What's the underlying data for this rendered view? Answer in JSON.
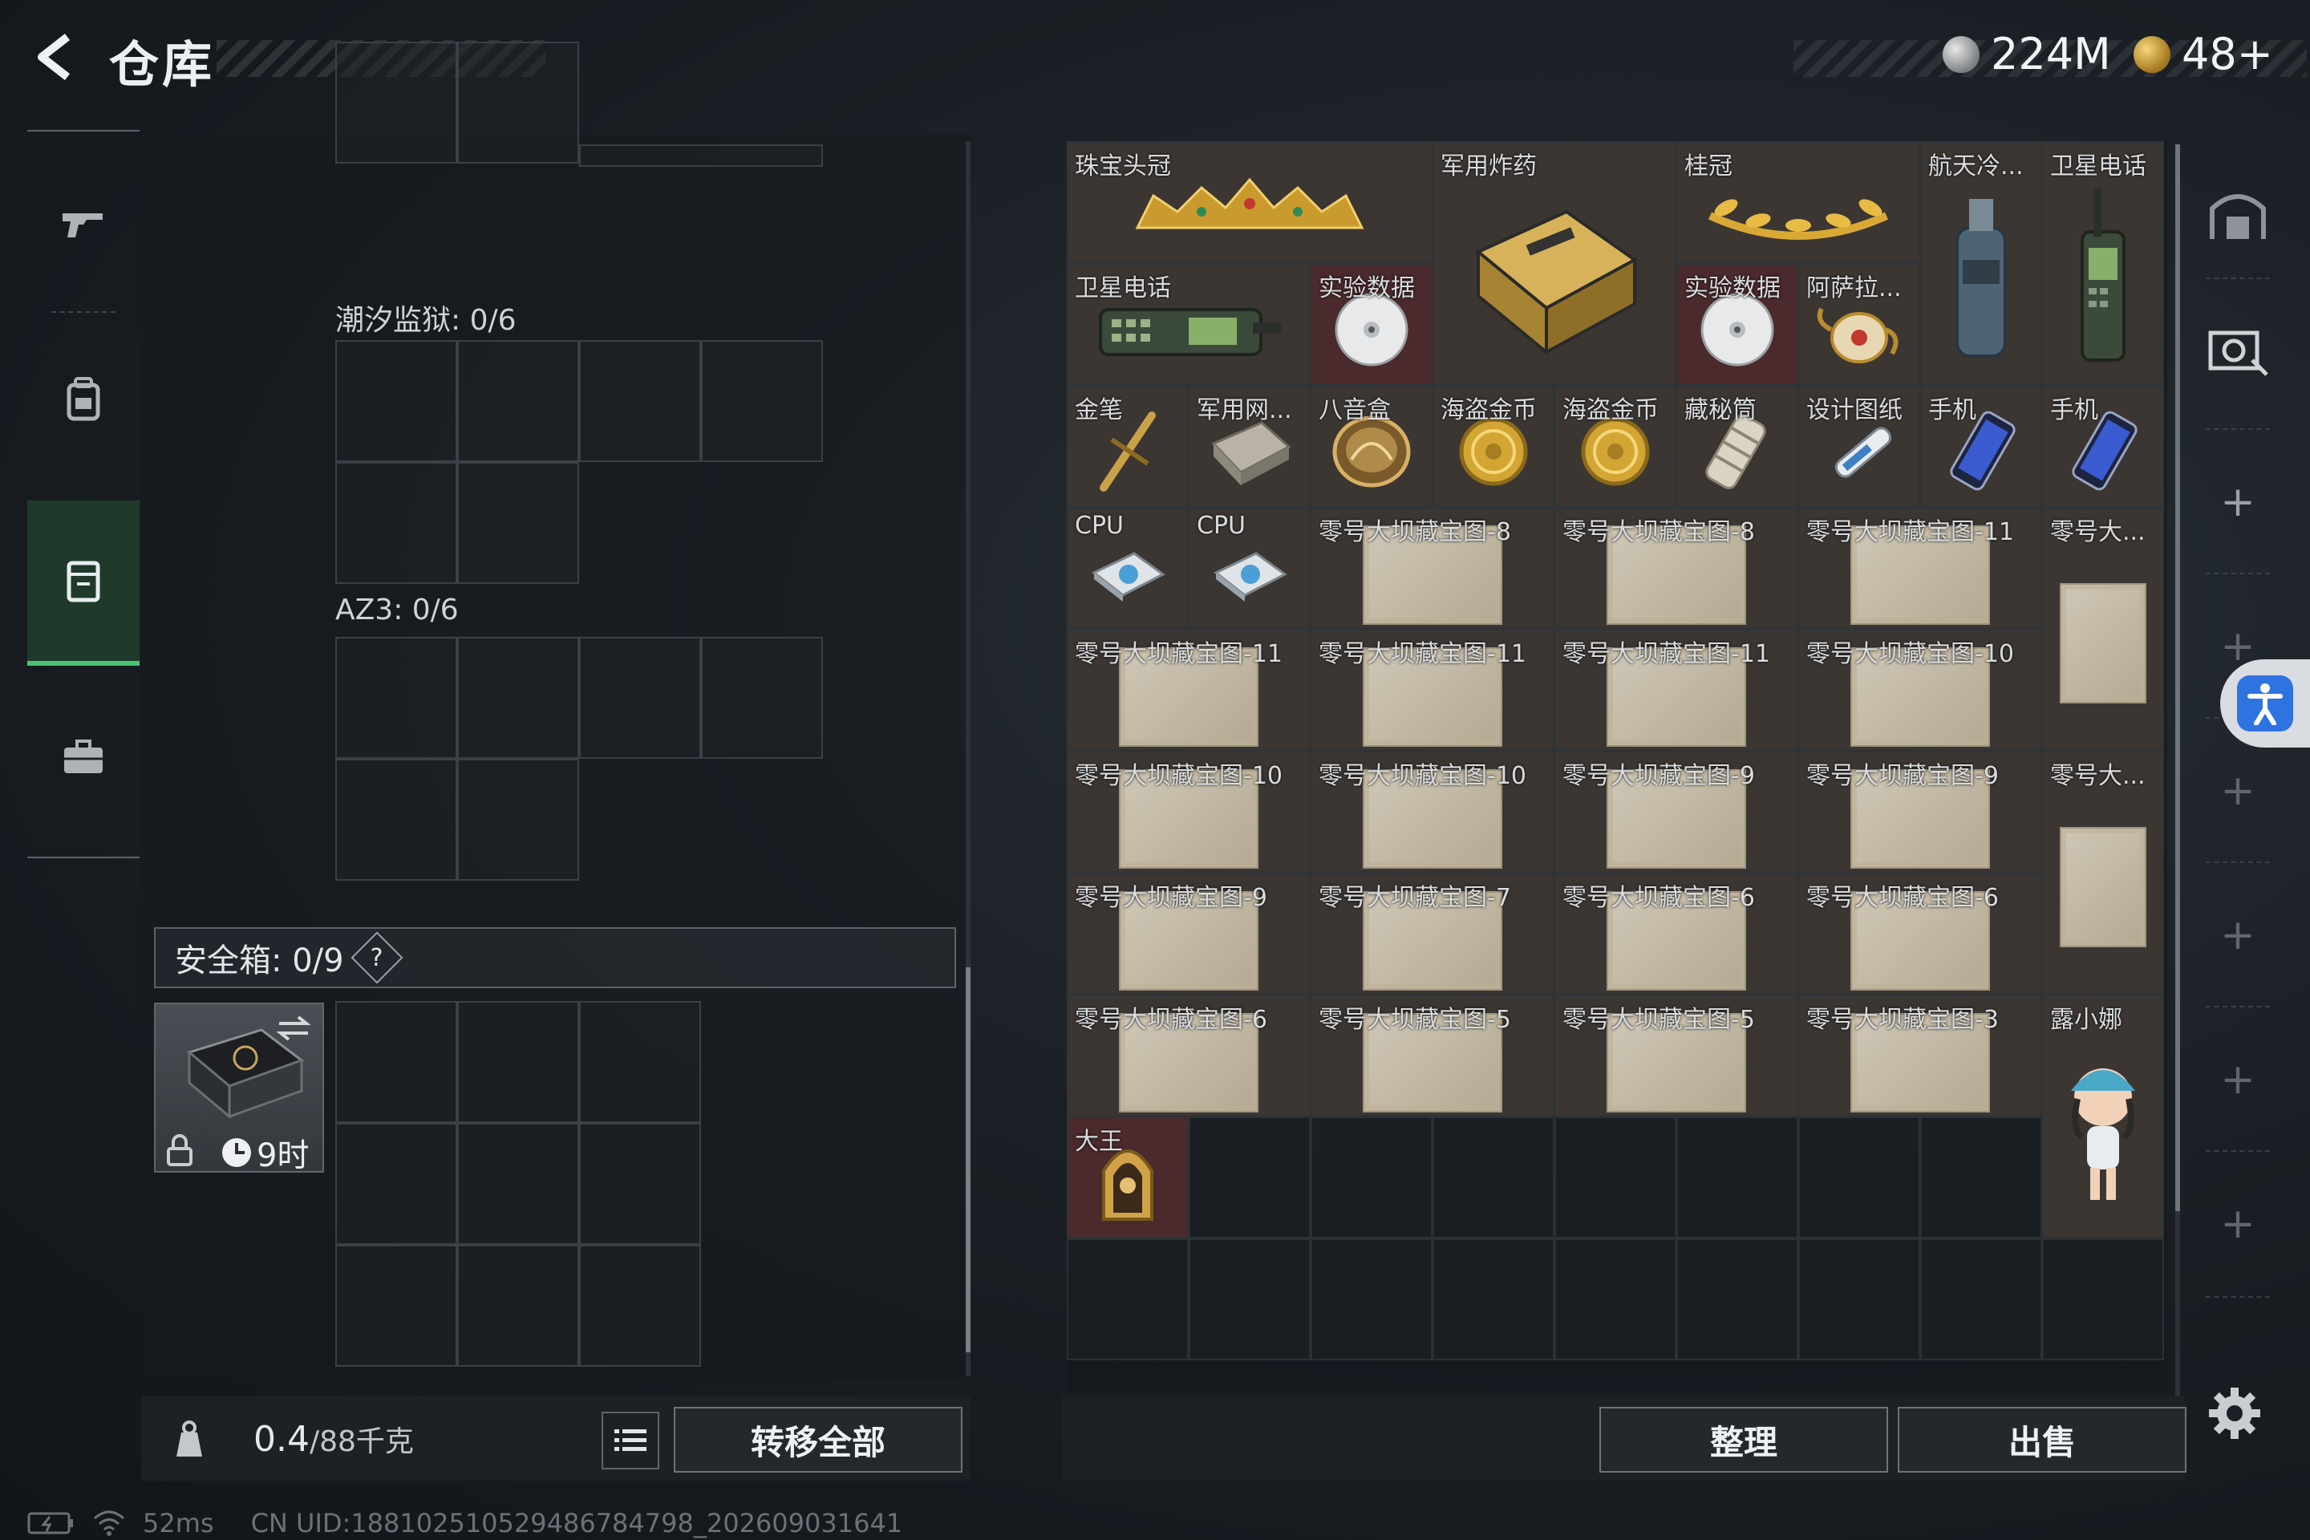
{
  "header": {
    "title": "仓库",
    "currency_silver": "224M",
    "currency_gold": "48+"
  },
  "sidebar": {
    "items": [
      {
        "icon": "gun-icon"
      },
      {
        "icon": "backpack-icon"
      },
      {
        "icon": "container-icon",
        "active": true
      },
      {
        "icon": "briefcase-icon"
      }
    ]
  },
  "left": {
    "label_tide_prison": "潮汐监狱: 0/6",
    "label_az3": "AZ3: 0/6",
    "safebox_label": "安全箱: 0/9",
    "safebox_help": "?",
    "safebox_timer": "9时",
    "weight_value": "0.4",
    "weight_capacity": "/88千克",
    "transfer_all": "转移全部"
  },
  "inventory": {
    "items": [
      {
        "name": "珠宝头冠"
      },
      {
        "name": "军用炸药"
      },
      {
        "name": "桂冠"
      },
      {
        "name": "航天冷..."
      },
      {
        "name": "卫星电话"
      },
      {
        "name": "卫星电话"
      },
      {
        "name": "实验数据"
      },
      {
        "name": "实验数据"
      },
      {
        "name": "阿萨拉..."
      },
      {
        "name": "金笔"
      },
      {
        "name": "军用网..."
      },
      {
        "name": "八音盒"
      },
      {
        "name": "海盗金币"
      },
      {
        "name": "海盗金币"
      },
      {
        "name": "藏秘筒"
      },
      {
        "name": "设计图纸"
      },
      {
        "name": "手机"
      },
      {
        "name": "手机"
      },
      {
        "name": "CPU"
      },
      {
        "name": "CPU"
      },
      {
        "name": "零号大坝藏宝图-8"
      },
      {
        "name": "零号大坝藏宝图-8"
      },
      {
        "name": "零号大坝藏宝图-11"
      },
      {
        "name": "零号大..."
      },
      {
        "name": "零号大坝藏宝图-11"
      },
      {
        "name": "零号大坝藏宝图-11"
      },
      {
        "name": "零号大坝藏宝图-11"
      },
      {
        "name": "零号大坝藏宝图-10"
      },
      {
        "name": "零号大坝藏宝图-10"
      },
      {
        "name": "零号大坝藏宝图-10"
      },
      {
        "name": "零号大坝藏宝图-9"
      },
      {
        "name": "零号大坝藏宝图-9"
      },
      {
        "name": "零号大..."
      },
      {
        "name": "零号大坝藏宝图-9"
      },
      {
        "name": "零号大坝藏宝图-7"
      },
      {
        "name": "零号大坝藏宝图-6"
      },
      {
        "name": "零号大坝藏宝图-6"
      },
      {
        "name": "零号大坝藏宝图-6"
      },
      {
        "name": "零号大坝藏宝图-5"
      },
      {
        "name": "零号大坝藏宝图-5"
      },
      {
        "name": "零号大坝藏宝图-3"
      },
      {
        "name": "露小娜"
      },
      {
        "name": "大王"
      }
    ],
    "sort_button": "整理",
    "sell_button": "出售"
  },
  "status": {
    "ping": "52ms",
    "uid": "CN UID:18810251052948678479​8_202609031641"
  }
}
